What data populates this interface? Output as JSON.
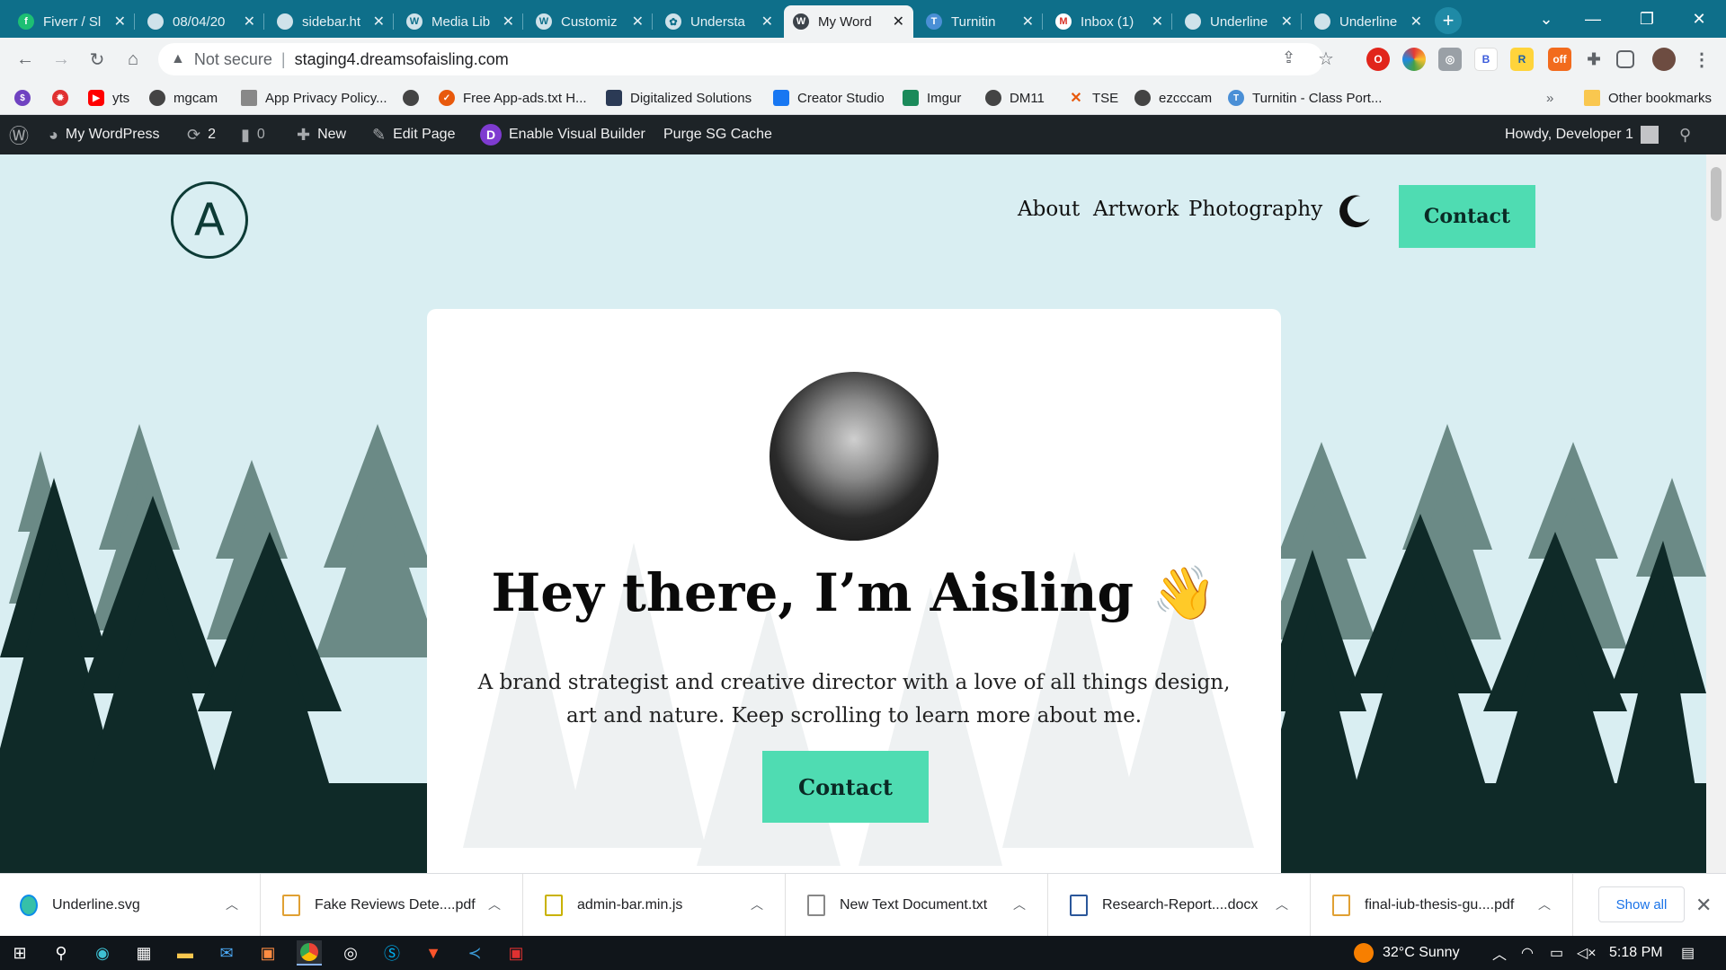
{
  "browser": {
    "tabs": [
      {
        "label": "Fiverr / Sl",
        "icon": "fiverr-icon"
      },
      {
        "label": "08/04/20",
        "icon": "globe-icon"
      },
      {
        "label": "sidebar.ht",
        "icon": "globe-icon"
      },
      {
        "label": "Media Lib",
        "icon": "wordpress-icon"
      },
      {
        "label": "Customiz",
        "icon": "wordpress-icon"
      },
      {
        "label": "Understa",
        "icon": "openai-icon"
      },
      {
        "label": "My Word",
        "icon": "wordpress-icon",
        "active": true
      },
      {
        "label": "Turnitin",
        "icon": "turnitin-icon"
      },
      {
        "label": "Inbox (1)",
        "icon": "gmail-icon"
      },
      {
        "label": "Underline",
        "icon": "globe-icon"
      },
      {
        "label": "Underline",
        "icon": "globe-icon"
      }
    ],
    "address": {
      "security": "Not secure",
      "url": "staging4.dreamsofaisling.com"
    },
    "bookmarks": [
      {
        "label": "",
        "icon": "dollar-sign-icon"
      },
      {
        "label": "",
        "icon": "gear-red-icon"
      },
      {
        "label": "yts",
        "icon": "youtube-icon"
      },
      {
        "label": "mgcam",
        "icon": "globe-icon"
      },
      {
        "label": "App Privacy Policy...",
        "icon": "document-icon"
      },
      {
        "label": "",
        "icon": "globe-icon"
      },
      {
        "label": "Free App-ads.txt H...",
        "icon": "shield-icon"
      },
      {
        "label": "Digitalized Solutions",
        "icon": "app-icon"
      },
      {
        "label": "Creator Studio",
        "icon": "clapperboard-icon"
      },
      {
        "label": "Imgur",
        "icon": "imgur-icon"
      },
      {
        "label": "DM11",
        "icon": "globe-icon"
      },
      {
        "label": "TSE",
        "icon": "x-icon"
      },
      {
        "label": "ezcccam",
        "icon": "globe-icon"
      },
      {
        "label": "Turnitin - Class Port...",
        "icon": "turnitin-icon"
      }
    ],
    "other_bookmarks": "Other bookmarks",
    "chevron": "»"
  },
  "wp_admin_bar": {
    "site_name": "My WordPress",
    "updates_count": "2",
    "comments_count": "0",
    "new_label": "New",
    "edit_page": "Edit Page",
    "visual_builder": "Enable Visual Builder",
    "purge_cache": "Purge SG Cache",
    "howdy": "Howdy, Developer 1"
  },
  "site": {
    "logo_letter": "A",
    "nav": [
      "About",
      "Artwork",
      "Photography"
    ],
    "nav_contact": "Contact",
    "hero_title": "Hey there, I’m Aisling 👋",
    "hero_text": "A brand strategist and creative director with a love of all things design, art and nature. Keep scrolling to learn more about me.",
    "hero_button": "Contact",
    "colors": {
      "accent": "#4fdcb2",
      "sky": "#d9eef2",
      "forest_dark": "#0f2a28",
      "forest_mid": "#6b8a86"
    }
  },
  "downloads": {
    "items": [
      {
        "name": "Underline.svg",
        "icon": "edge-icon"
      },
      {
        "name": "Fake Reviews Dete....pdf",
        "icon": "pdf-icon"
      },
      {
        "name": "admin-bar.min.js",
        "icon": "js-file-icon"
      },
      {
        "name": "New Text Document.txt",
        "icon": "text-file-icon"
      },
      {
        "name": "Research-Report....docx",
        "icon": "word-icon"
      },
      {
        "name": "final-iub-thesis-gu....pdf",
        "icon": "pdf-icon"
      }
    ],
    "show_all": "Show all"
  },
  "taskbar": {
    "weather": "32°C  Sunny",
    "time": "5:18 PM"
  }
}
